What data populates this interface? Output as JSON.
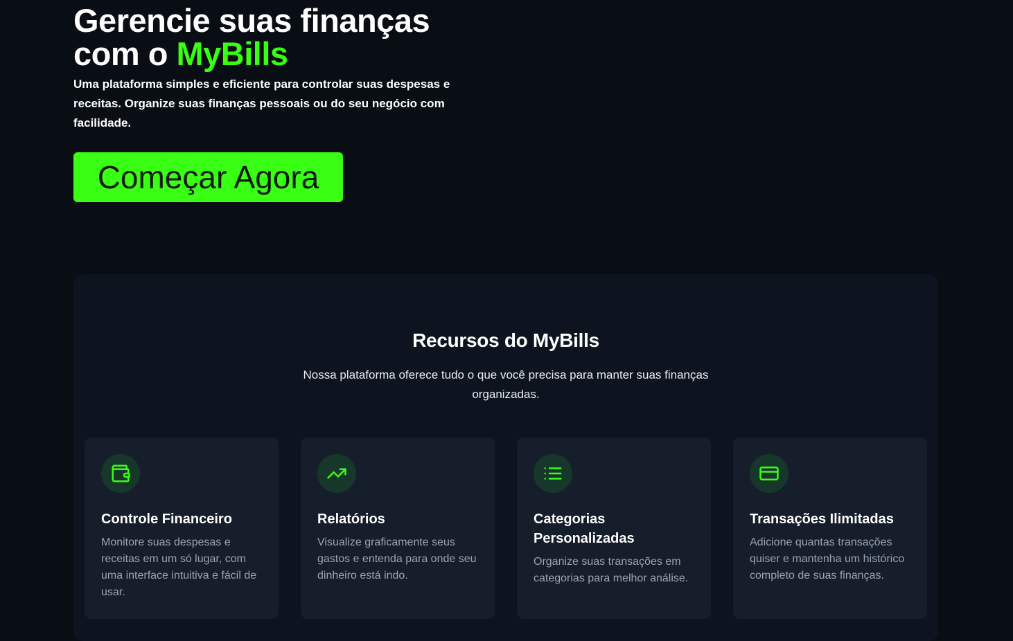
{
  "hero": {
    "title_line1": "Gerencie suas finanças",
    "title_prefix": "com o ",
    "title_brand": "MyBills",
    "subtitle": "Uma plataforma simples e eficiente para controlar suas despesas e receitas. Organize suas finanças pessoais ou do seu negócio com facilidade.",
    "cta_label": "Começar Agora"
  },
  "features": {
    "title": "Recursos do MyBills",
    "subtitle": "Nossa plataforma oferece tudo o que você precisa para manter suas finanças organizadas.",
    "cards": [
      {
        "icon": "wallet-icon",
        "title": "Controle Financeiro",
        "description": "Monitore suas despesas e receitas em um só lugar, com uma interface intuitiva e fácil de usar."
      },
      {
        "icon": "trending-up-icon",
        "title": "Relatórios",
        "description": "Visualize graficamente seus gastos e entenda para onde seu dinheiro está indo."
      },
      {
        "icon": "list-icon",
        "title": "Categorias Personalizadas",
        "description": "Organize suas transações em categorias para melhor análise."
      },
      {
        "icon": "credit-card-icon",
        "title": "Transações Ilimitadas",
        "description": "Adicione quantas transações quiser e mantenha um histórico completo de suas finanças."
      }
    ]
  },
  "colors": {
    "background": "#090d14",
    "accent": "#39ff14",
    "panel": "#0e141f",
    "card": "#161e2b",
    "icon_bg": "#16372a",
    "muted_text": "#9aa3b2"
  }
}
